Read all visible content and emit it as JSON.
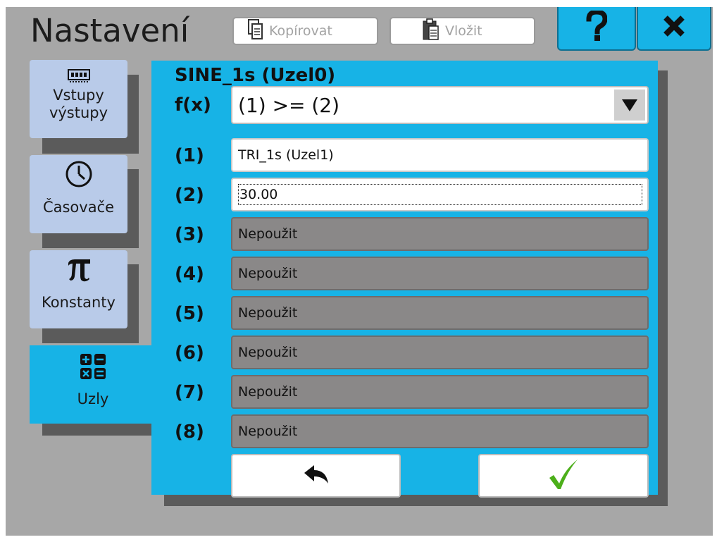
{
  "header": {
    "title": "Nastavení",
    "copy_label": "Kopírovat",
    "paste_label": "Vložit",
    "help_icon": "question-mark-icon",
    "close_icon": "close-x-icon"
  },
  "sidebar": {
    "items": [
      {
        "icon": "memory-chip-icon",
        "label_line1": "Vstupy",
        "label_line2": "výstupy"
      },
      {
        "icon": "clock-icon",
        "label": "Časovače"
      },
      {
        "icon": "pi-icon",
        "label": "Konstanty"
      },
      {
        "icon": "calculator-icon",
        "label": "Uzly",
        "active": true
      }
    ]
  },
  "panel": {
    "title": "SINE_1s (Uzel0)",
    "fx_label": "f(x)",
    "fx_value": "(1) >= (2)",
    "rows": [
      {
        "label": "(1)",
        "value": "TRI_1s (Uzel1)",
        "state": "active"
      },
      {
        "label": "(2)",
        "value": "30.00",
        "state": "editing"
      },
      {
        "label": "(3)",
        "value": "Nepoužit",
        "state": "unused"
      },
      {
        "label": "(4)",
        "value": "Nepoužit",
        "state": "unused"
      },
      {
        "label": "(5)",
        "value": "Nepoužit",
        "state": "unused"
      },
      {
        "label": "(6)",
        "value": "Nepoužit",
        "state": "unused"
      },
      {
        "label": "(7)",
        "value": "Nepoužit",
        "state": "unused"
      },
      {
        "label": "(8)",
        "value": "Nepoužit",
        "state": "unused"
      }
    ],
    "back_icon": "back-arrow-icon",
    "ok_icon": "checkmark-icon"
  },
  "colors": {
    "accent": "#17b3e6",
    "background": "#a7a7a7",
    "tab": "#b9cbe9",
    "unused_field": "#8a8888",
    "check": "#4caf1a"
  }
}
